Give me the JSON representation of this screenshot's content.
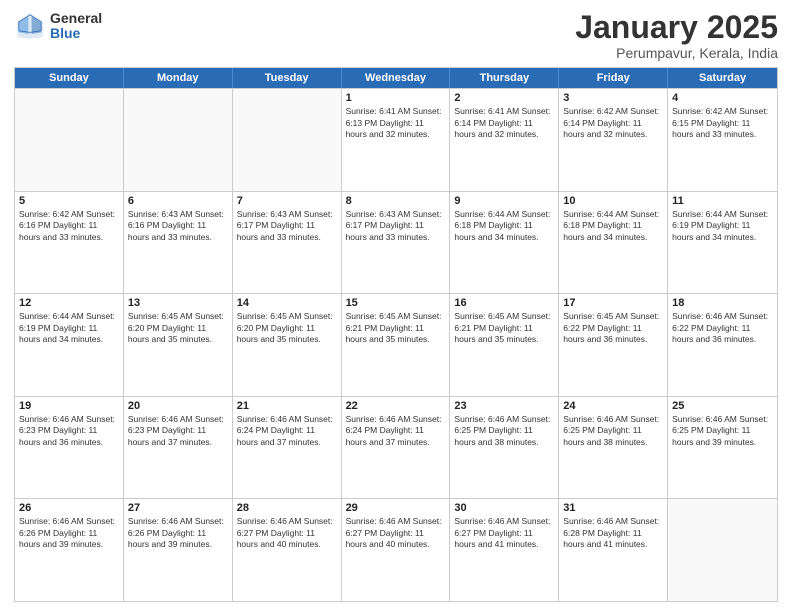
{
  "logo": {
    "general": "General",
    "blue": "Blue"
  },
  "title": "January 2025",
  "subtitle": "Perumpavur, Kerala, India",
  "header_days": [
    "Sunday",
    "Monday",
    "Tuesday",
    "Wednesday",
    "Thursday",
    "Friday",
    "Saturday"
  ],
  "weeks": [
    [
      {
        "day": "",
        "info": ""
      },
      {
        "day": "",
        "info": ""
      },
      {
        "day": "",
        "info": ""
      },
      {
        "day": "1",
        "info": "Sunrise: 6:41 AM\nSunset: 6:13 PM\nDaylight: 11 hours\nand 32 minutes."
      },
      {
        "day": "2",
        "info": "Sunrise: 6:41 AM\nSunset: 6:14 PM\nDaylight: 11 hours\nand 32 minutes."
      },
      {
        "day": "3",
        "info": "Sunrise: 6:42 AM\nSunset: 6:14 PM\nDaylight: 11 hours\nand 32 minutes."
      },
      {
        "day": "4",
        "info": "Sunrise: 6:42 AM\nSunset: 6:15 PM\nDaylight: 11 hours\nand 33 minutes."
      }
    ],
    [
      {
        "day": "5",
        "info": "Sunrise: 6:42 AM\nSunset: 6:16 PM\nDaylight: 11 hours\nand 33 minutes."
      },
      {
        "day": "6",
        "info": "Sunrise: 6:43 AM\nSunset: 6:16 PM\nDaylight: 11 hours\nand 33 minutes."
      },
      {
        "day": "7",
        "info": "Sunrise: 6:43 AM\nSunset: 6:17 PM\nDaylight: 11 hours\nand 33 minutes."
      },
      {
        "day": "8",
        "info": "Sunrise: 6:43 AM\nSunset: 6:17 PM\nDaylight: 11 hours\nand 33 minutes."
      },
      {
        "day": "9",
        "info": "Sunrise: 6:44 AM\nSunset: 6:18 PM\nDaylight: 11 hours\nand 34 minutes."
      },
      {
        "day": "10",
        "info": "Sunrise: 6:44 AM\nSunset: 6:18 PM\nDaylight: 11 hours\nand 34 minutes."
      },
      {
        "day": "11",
        "info": "Sunrise: 6:44 AM\nSunset: 6:19 PM\nDaylight: 11 hours\nand 34 minutes."
      }
    ],
    [
      {
        "day": "12",
        "info": "Sunrise: 6:44 AM\nSunset: 6:19 PM\nDaylight: 11 hours\nand 34 minutes."
      },
      {
        "day": "13",
        "info": "Sunrise: 6:45 AM\nSunset: 6:20 PM\nDaylight: 11 hours\nand 35 minutes."
      },
      {
        "day": "14",
        "info": "Sunrise: 6:45 AM\nSunset: 6:20 PM\nDaylight: 11 hours\nand 35 minutes."
      },
      {
        "day": "15",
        "info": "Sunrise: 6:45 AM\nSunset: 6:21 PM\nDaylight: 11 hours\nand 35 minutes."
      },
      {
        "day": "16",
        "info": "Sunrise: 6:45 AM\nSunset: 6:21 PM\nDaylight: 11 hours\nand 35 minutes."
      },
      {
        "day": "17",
        "info": "Sunrise: 6:45 AM\nSunset: 6:22 PM\nDaylight: 11 hours\nand 36 minutes."
      },
      {
        "day": "18",
        "info": "Sunrise: 6:46 AM\nSunset: 6:22 PM\nDaylight: 11 hours\nand 36 minutes."
      }
    ],
    [
      {
        "day": "19",
        "info": "Sunrise: 6:46 AM\nSunset: 6:23 PM\nDaylight: 11 hours\nand 36 minutes."
      },
      {
        "day": "20",
        "info": "Sunrise: 6:46 AM\nSunset: 6:23 PM\nDaylight: 11 hours\nand 37 minutes."
      },
      {
        "day": "21",
        "info": "Sunrise: 6:46 AM\nSunset: 6:24 PM\nDaylight: 11 hours\nand 37 minutes."
      },
      {
        "day": "22",
        "info": "Sunrise: 6:46 AM\nSunset: 6:24 PM\nDaylight: 11 hours\nand 37 minutes."
      },
      {
        "day": "23",
        "info": "Sunrise: 6:46 AM\nSunset: 6:25 PM\nDaylight: 11 hours\nand 38 minutes."
      },
      {
        "day": "24",
        "info": "Sunrise: 6:46 AM\nSunset: 6:25 PM\nDaylight: 11 hours\nand 38 minutes."
      },
      {
        "day": "25",
        "info": "Sunrise: 6:46 AM\nSunset: 6:25 PM\nDaylight: 11 hours\nand 39 minutes."
      }
    ],
    [
      {
        "day": "26",
        "info": "Sunrise: 6:46 AM\nSunset: 6:26 PM\nDaylight: 11 hours\nand 39 minutes."
      },
      {
        "day": "27",
        "info": "Sunrise: 6:46 AM\nSunset: 6:26 PM\nDaylight: 11 hours\nand 39 minutes."
      },
      {
        "day": "28",
        "info": "Sunrise: 6:46 AM\nSunset: 6:27 PM\nDaylight: 11 hours\nand 40 minutes."
      },
      {
        "day": "29",
        "info": "Sunrise: 6:46 AM\nSunset: 6:27 PM\nDaylight: 11 hours\nand 40 minutes."
      },
      {
        "day": "30",
        "info": "Sunrise: 6:46 AM\nSunset: 6:27 PM\nDaylight: 11 hours\nand 41 minutes."
      },
      {
        "day": "31",
        "info": "Sunrise: 6:46 AM\nSunset: 6:28 PM\nDaylight: 11 hours\nand 41 minutes."
      },
      {
        "day": "",
        "info": ""
      }
    ]
  ]
}
